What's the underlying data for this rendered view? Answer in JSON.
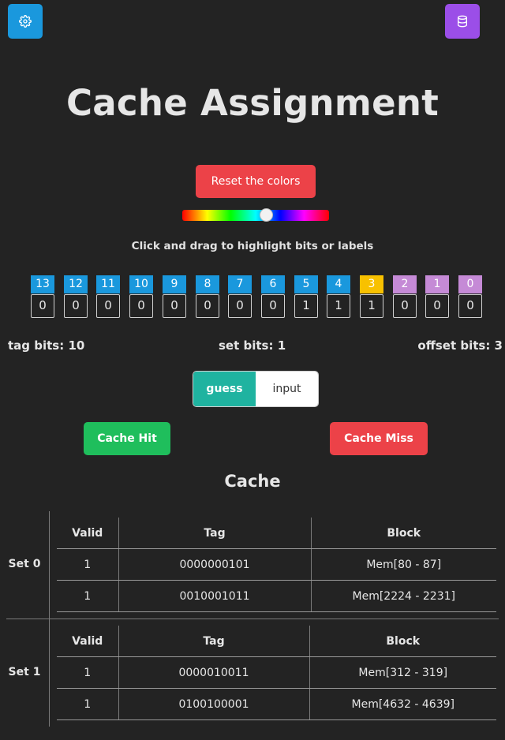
{
  "header": {
    "title": "Cache Assignment",
    "settings_icon": "gear-icon",
    "database_icon": "database-icon"
  },
  "controls": {
    "reset_label": "Reset the colors",
    "hue_value": 0.57,
    "instruction": "Click and drag to highlight bits or labels"
  },
  "bits": [
    {
      "label": "13",
      "value": "0",
      "color": "#1a98dd"
    },
    {
      "label": "12",
      "value": "0",
      "color": "#1a98dd"
    },
    {
      "label": "11",
      "value": "0",
      "color": "#1a98dd"
    },
    {
      "label": "10",
      "value": "0",
      "color": "#1a98dd"
    },
    {
      "label": "9",
      "value": "0",
      "color": "#1a98dd"
    },
    {
      "label": "8",
      "value": "0",
      "color": "#1a98dd"
    },
    {
      "label": "7",
      "value": "0",
      "color": "#1a98dd"
    },
    {
      "label": "6",
      "value": "0",
      "color": "#1a98dd"
    },
    {
      "label": "5",
      "value": "1",
      "color": "#1a98dd"
    },
    {
      "label": "4",
      "value": "1",
      "color": "#1a98dd"
    },
    {
      "label": "3",
      "value": "1",
      "color": "#f8c100"
    },
    {
      "label": "2",
      "value": "0",
      "color": "#c58ad6"
    },
    {
      "label": "1",
      "value": "0",
      "color": "#c58ad6"
    },
    {
      "label": "0",
      "value": "0",
      "color": "#c58ad6"
    }
  ],
  "fields": {
    "tag": "tag bits: 10",
    "set": "set bits: 1",
    "offset": "offset bits: 3"
  },
  "mode_toggle": {
    "guess_label": "guess",
    "input_label": "input",
    "selected": "guess"
  },
  "actions": {
    "hit_label": "Cache Hit",
    "miss_label": "Cache Miss"
  },
  "cache": {
    "title": "Cache",
    "columns": [
      "Valid",
      "Tag",
      "Block"
    ],
    "sets": [
      {
        "label": "Set 0",
        "rows": [
          {
            "valid": "1",
            "tag": "0000000101",
            "block": "Mem[80 - 87]"
          },
          {
            "valid": "1",
            "tag": "0010001011",
            "block": "Mem[2224 - 2231]"
          }
        ]
      },
      {
        "label": "Set 1",
        "rows": [
          {
            "valid": "1",
            "tag": "0000010011",
            "block": "Mem[312 - 319]"
          },
          {
            "valid": "1",
            "tag": "0100100001",
            "block": "Mem[4632 - 4639]"
          }
        ]
      }
    ]
  },
  "colors": {
    "background": "#232323",
    "blue": "#1a98dd",
    "purple": "#9b4ee8",
    "red": "#ec4248",
    "green": "#1fbe5c",
    "teal": "#1fb3a0",
    "yellow": "#f8c100",
    "lavender": "#c58ad6"
  }
}
